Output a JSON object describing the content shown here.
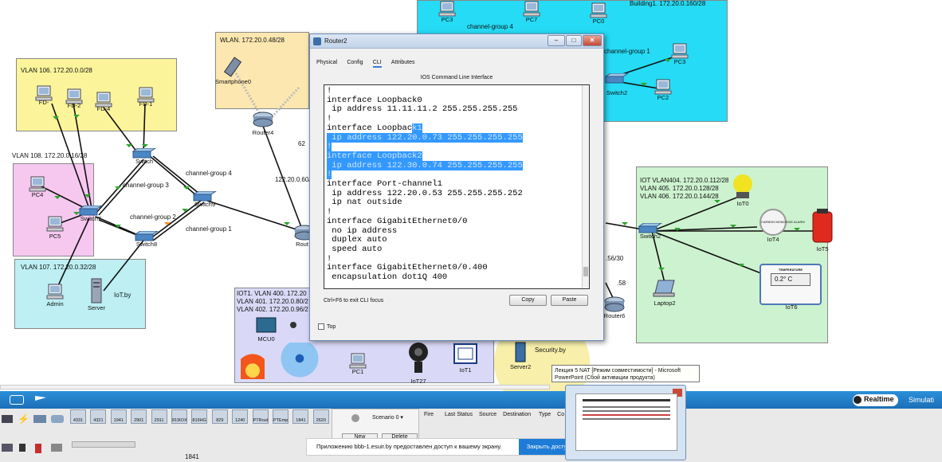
{
  "zones": {
    "vlan106": "VLAN 106. 172.20.0.0/28",
    "vlan108": "VLAN 108. 172.20.0.16/28",
    "vlan107": "VLAN 107. 172.20.0.32/28",
    "wlan": "WLAN. 172.20.0.48/28",
    "building1": "Building1. 172.20.0.160/28",
    "iot_l1": "IOT VLAN404. 172.20.0.112/28",
    "iot_l2": "VLAN 405. 172.20.0.128/28",
    "iot_l3": "VLAN 406. 172.20.0.144/28",
    "iot1_l1": "IOT1. VLAN 400. 172.20",
    "iot1_l2": "VLAN 401. 172.20.0.80/2",
    "iot1_l3": "VLAN 402. 172.20.0.96/2"
  },
  "devices": {
    "fd": "FD-",
    "fd2": "FD-2",
    "fd4": "FD-4",
    "fd1": "FD-1",
    "pc4": "PC4",
    "pc5": "PC5",
    "switch7": "Switch7",
    "switch8": "Switch8",
    "switch9": "Switch9",
    "switch_top": "Switch",
    "admin": "Admin",
    "server": "Server",
    "iotby": "IoT.by",
    "smartphone0": "Smartphone0",
    "router4": "Router4",
    "rout": "Rout",
    "pc3b": "PC3",
    "pc7": "PC7",
    "pc0": "PC0",
    "pc3": "PC3",
    "pc2": "PC2",
    "switch2_b": "Switch2",
    "switch2_i": "Switch2",
    "iot0": "IoT0",
    "iot4": "IoT4",
    "iot5": "IoT5",
    "iot6": "IoT6",
    "laptop2": "Laptop2",
    "router6": "Router6",
    "mcu0": "MCU0",
    "pc1": "PC1",
    "iot1": "IoT1",
    "iot27": "IoT27",
    "server2": "Server2",
    "securityby": "Security.by",
    "co_alarm": "CARBON MONOXIDE ALARM",
    "thermo_head": "TEMPERATURE",
    "thermo": "0.2° C"
  },
  "links": {
    "cg3": "channel-group 3",
    "cg4": "channel-group 4",
    "cg2": "channel-group 2",
    "cg1": "channel-group 1",
    "cg4b": "channel-group 4",
    "cg1b": "channel-group 1",
    "net_60": "122.20.0.60/",
    "num62": "62",
    "net_5630": ".56/30",
    "num58": ".58"
  },
  "dialog": {
    "title": "Router2",
    "tabs": [
      "Physical",
      "Config",
      "CLI",
      "Attributes"
    ],
    "active_tab": "CLI",
    "ios_title": "IOS Command Line Interface",
    "cli": [
      {
        "t": "!"
      },
      {
        "t": "interface Loopback0"
      },
      {
        "t": " ip address 11.11.11.2 255.255.255.255"
      },
      {
        "t": "!"
      },
      {
        "t": "interface Loopbac",
        "s": "k1"
      },
      {
        "t": "",
        "s": " ip address 122.20.0.73 255.255.255.255"
      },
      {
        "t": "",
        "s": "!"
      },
      {
        "t": "",
        "s": "interface Loopback2"
      },
      {
        "t": "",
        "s": " ip address 122.30.0.74 255.255.255.255"
      },
      {
        "t": "",
        "s": "!"
      },
      {
        "t": "interface Port-channel1"
      },
      {
        "t": " ip address 122.20.0.53 255.255.255.252"
      },
      {
        "t": " ip nat outside"
      },
      {
        "t": "!"
      },
      {
        "t": "interface GigabitEthernet0/0"
      },
      {
        "t": " no ip address"
      },
      {
        "t": " duplex auto"
      },
      {
        "t": " speed auto"
      },
      {
        "t": "!"
      },
      {
        "t": "interface GigabitEthernet0/0.400"
      },
      {
        "t": " encapsulation dot1Q 400"
      }
    ],
    "hint": "Ctrl+F6 to exit CLI focus",
    "copy": "Copy",
    "paste": "Paste",
    "top": "Top"
  },
  "bottom": {
    "realtime": "Realtime",
    "simulation": "Simulati",
    "scenario": "Scenario 0",
    "cols": [
      "Fire",
      "Last Status",
      "Source",
      "Destination",
      "Type",
      "Co"
    ],
    "device_types": [
      "4331",
      "4321",
      "1941",
      "2901",
      "2911",
      "819IOX",
      "819HGW",
      "829",
      "1240",
      "PTRouter",
      "PTEmpty",
      "1841",
      "2620"
    ],
    "model": "1841",
    "new_btn": "New",
    "delete_btn": "Delete"
  },
  "notification": {
    "text": "Приложению bbb-1.esuir.by предоставлен доступ к вашему экрану.",
    "button": "Закрыть досту"
  },
  "tooltip": "Лекция 5 NAT [Режим совместимости] - Microsoft PowerPoint (Сбой активации продукта)"
}
